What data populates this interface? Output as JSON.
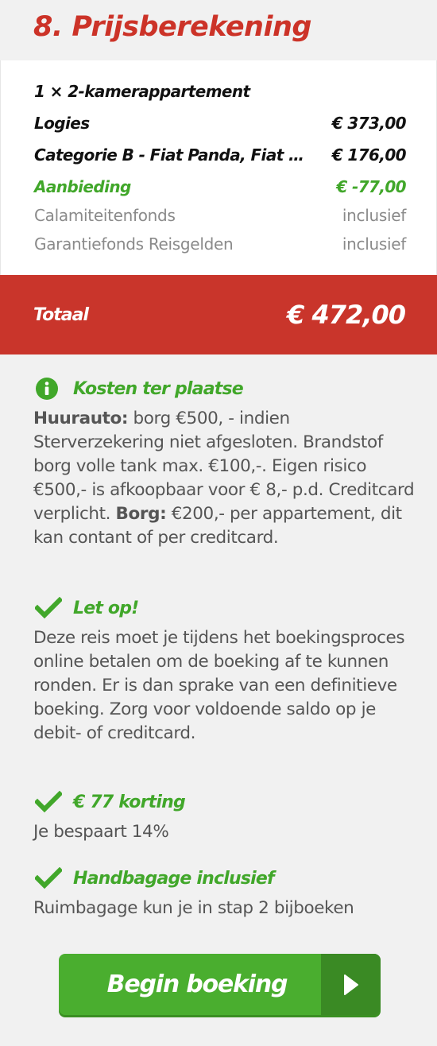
{
  "header": {
    "title": "8. Prijsberekening"
  },
  "summary": {
    "lines": [
      {
        "label": "1 × 2-kamerappartement",
        "value": ""
      },
      {
        "label": "Logies",
        "value": "€ 373,00"
      },
      {
        "label": "Categorie B - Fiat Panda, Fiat 5…",
        "value": "€ 176,00"
      },
      {
        "label": "Aanbieding",
        "value": "€ -77,00"
      },
      {
        "label": "Calamiteitenfonds",
        "value": "inclusief"
      },
      {
        "label": "Garantiefonds Reisgelden",
        "value": "inclusief"
      }
    ]
  },
  "total": {
    "label": "Totaal",
    "value": "€ 472,00"
  },
  "blocks": [
    {
      "icon": "info-icon",
      "title": "Kosten ter plaatse",
      "b1": "Huurauto:",
      "t1": " borg €500, - indien Sterverzekering niet afgesloten. Brandstof borg volle tank max. €100,-. Eigen risico €500,- is afkoopbaar voor € 8,- p.d. Creditcard verplicht. ",
      "b2": "Borg:",
      "t2": " €200,- per appartement, dit kan contant of per creditcard."
    },
    {
      "icon": "check-icon",
      "title": "Let op!",
      "text": "Deze reis moet je tijdens het boekingsproces online betalen om de boeking af te kunnen ronden. Er is dan sprake van een definitieve boeking. Zorg voor voldoende saldo op je debit- of creditcard."
    },
    {
      "icon": "check-icon",
      "title": "€ 77 korting",
      "text": "Je bespaart 14%"
    },
    {
      "icon": "check-icon",
      "title": "Handbagage inclusief",
      "text": "Ruimbagage kun je in stap 2 bijboeken"
    }
  ],
  "cta": {
    "label": "Begin boeking",
    "icon": "play-arrow-icon"
  },
  "colors": {
    "accent_red": "#c9352b",
    "title_red": "#cc3328",
    "green": "#41a72a",
    "button_green": "#4aae2f",
    "button_dark_green": "#3a8a24"
  }
}
